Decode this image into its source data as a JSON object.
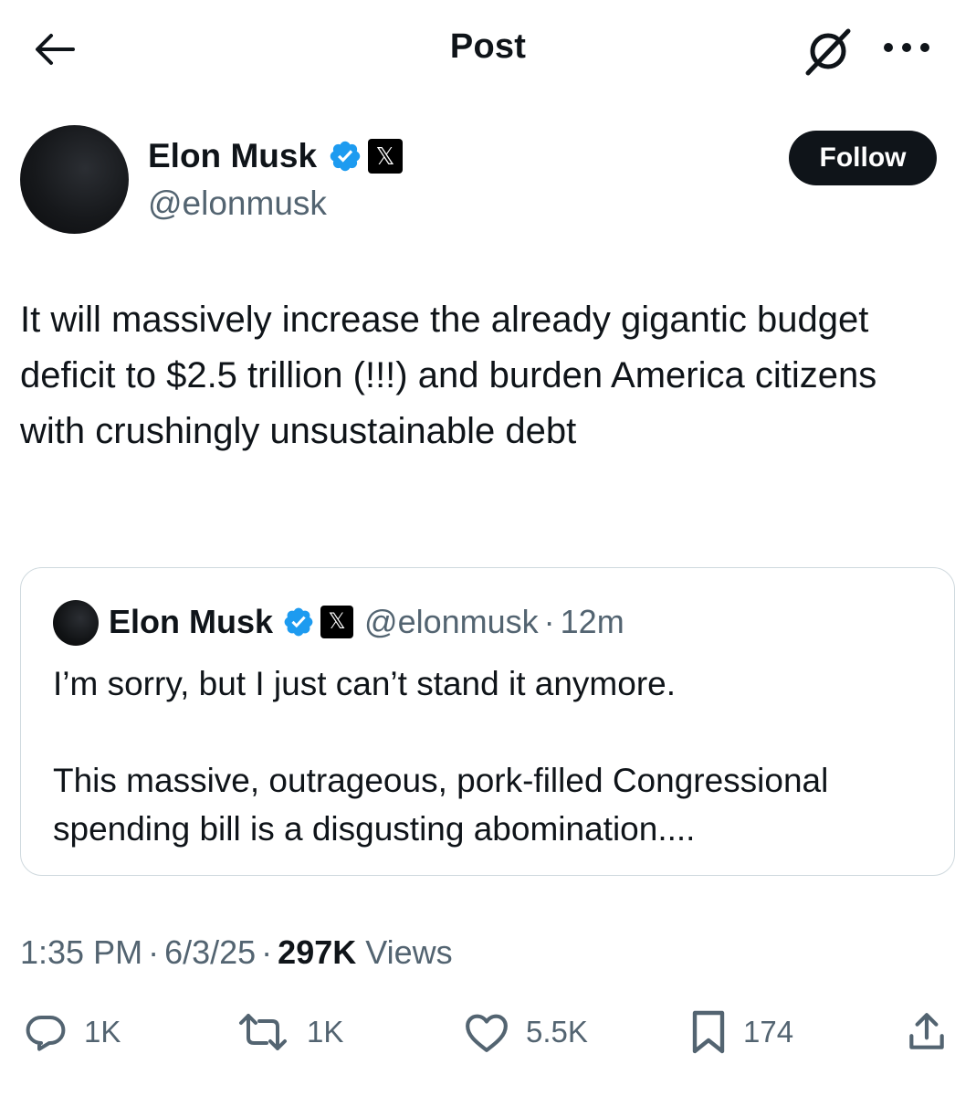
{
  "header": {
    "title": "Post",
    "back_icon": "back-arrow-icon",
    "grok_icon": "grok-icon",
    "more_icon": "more-dots-icon"
  },
  "author": {
    "name": "Elon Musk",
    "handle": "@elonmusk",
    "verified_color": "#1d9bf0",
    "affiliate_badge": "𝕏",
    "follow_label": "Follow"
  },
  "post": {
    "text": "It will massively increase the already gigantic budget deficit to $2.5 trillion (!!!) and burden America citizens with crushingly unsustainable debt"
  },
  "quote": {
    "name": "Elon Musk",
    "affiliate_badge": "𝕏",
    "handle": "@elonmusk",
    "dot": "·",
    "time": "12m",
    "line1": "I’m sorry, but I just can’t stand it anymore.",
    "line2": "This massive, outrageous, pork-filled Congressional spending bill is a disgusting abomination...."
  },
  "meta": {
    "time": "1:35 PM",
    "sep": "·",
    "date": "6/3/25",
    "views_count": "297K",
    "views_label": "Views"
  },
  "actions": {
    "replies": "1K",
    "reposts": "1K",
    "likes": "5.5K",
    "bookmarks": "174"
  },
  "colors": {
    "text": "#0f1419",
    "secondary": "#536471",
    "border": "#cfd9de",
    "verified": "#1d9bf0"
  }
}
